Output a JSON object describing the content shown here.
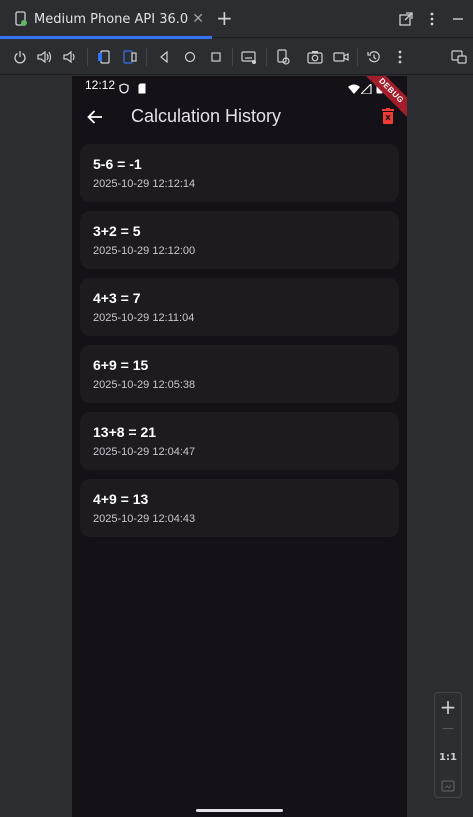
{
  "ide": {
    "tab_title": "Medium Phone API 36.0",
    "tab_close": "✕",
    "tab_add": "+"
  },
  "toolbar": {
    "icons": [
      "power-icon",
      "volume-up-icon",
      "volume-down-icon",
      "rotate-left-icon",
      "rotate-right-icon",
      "back-icon",
      "home-icon",
      "overview-icon",
      "keyboard-icon",
      "device-settings-icon",
      "screenshot-icon",
      "screen-record-icon",
      "snapshot-icon",
      "more-icon",
      "window-icon"
    ]
  },
  "device": {
    "status_time": "12:12",
    "debug_banner": "DEBUG"
  },
  "app": {
    "title": "Calculation History",
    "accent_delete": "#f23b32",
    "history": [
      {
        "expression": "5-6 = -1",
        "timestamp": "2025-10-29 12:12:14"
      },
      {
        "expression": "3+2 = 5",
        "timestamp": "2025-10-29 12:12:00"
      },
      {
        "expression": "4+3 = 7",
        "timestamp": "2025-10-29 12:11:04"
      },
      {
        "expression": "6+9 = 15",
        "timestamp": "2025-10-29 12:05:38"
      },
      {
        "expression": "13+8 = 21",
        "timestamp": "2025-10-29 12:04:47"
      },
      {
        "expression": "4+9 = 13",
        "timestamp": "2025-10-29 12:04:43"
      }
    ]
  },
  "zoom": {
    "zoom_in": "+",
    "zoom_out": "—",
    "actual_size": "1:1"
  }
}
